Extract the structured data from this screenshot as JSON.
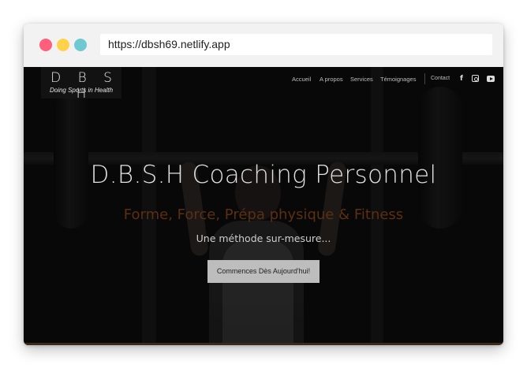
{
  "browser": {
    "url": "https://dbsh69.netlify.app",
    "controls": {
      "close_color": "#ff5f7a",
      "minimize_color": "#ffd24a",
      "maximize_color": "#6ec9d1"
    }
  },
  "site": {
    "logo": {
      "text": "D B S H",
      "subtitle": "Doing Sports in Health"
    },
    "nav": {
      "items": [
        {
          "label": "Accueil"
        },
        {
          "label": "A propos"
        },
        {
          "label": "Services"
        },
        {
          "label": "Témoignages"
        },
        {
          "label": "Contact"
        }
      ],
      "social": [
        "facebook-icon",
        "instagram-icon",
        "youtube-icon"
      ]
    },
    "hero": {
      "title": "D.B.S.H Coaching Personnel",
      "subtitle": "Forme, Force, Prépa physique & Fitness",
      "tagline": "Une méthode sur-mesure...",
      "cta_label": "Commences Dès Aujourd'hui!"
    },
    "colors": {
      "accent": "#5a2f12",
      "background": "#0d0d0d"
    }
  }
}
